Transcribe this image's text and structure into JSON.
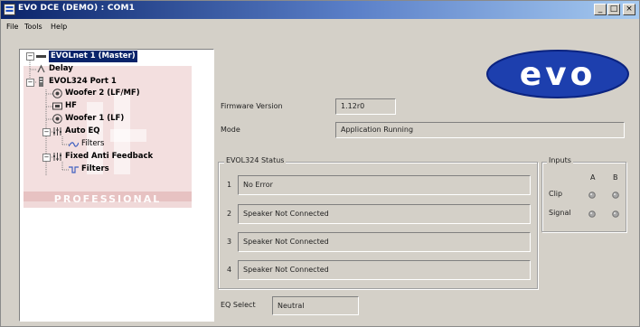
{
  "window": {
    "title": "EVO DCE (DEMO) : COM1",
    "minimize_label": "_",
    "maximize_label": "□",
    "close_label": "×"
  },
  "menu": [
    "File",
    "Tools",
    "Help"
  ],
  "tree": {
    "root": "EVOLnet 1 (Master)",
    "delay": "Delay",
    "port": "EVOL324 Port 1",
    "woofer2": "Woofer 2 (LF/MF)",
    "hf": "HF",
    "woofer1": "Woofer 1 (LF)",
    "auto_eq": "Auto EQ",
    "auto_eq_filters": "Filters",
    "fixed_af": "Fixed Anti Feedback",
    "fixed_af_filters": "Filters"
  },
  "watermark": {
    "professional": "PROFESSIONAL"
  },
  "logo": {
    "text": "evo"
  },
  "info": {
    "firmware_label": "Firmware Version",
    "firmware_value": "1.12r0",
    "mode_label": "Mode",
    "mode_value": "Application Running"
  },
  "status": {
    "title": "EVOL324 Status",
    "rows": [
      {
        "num": "1",
        "text": "No Error"
      },
      {
        "num": "2",
        "text": "Speaker Not Connected"
      },
      {
        "num": "3",
        "text": "Speaker Not Connected"
      },
      {
        "num": "4",
        "text": "Speaker Not Connected"
      }
    ]
  },
  "inputs": {
    "title": "Inputs",
    "col_a": "A",
    "col_b": "B",
    "clip_label": "Clip",
    "signal_label": "Signal"
  },
  "eq": {
    "label": "EQ Select",
    "value": "Neutral"
  },
  "colors": {
    "titlebar": "#0a246a",
    "face": "#d4d0c8",
    "logo_blue": "#1d3fae",
    "selection": "#0a246a"
  }
}
